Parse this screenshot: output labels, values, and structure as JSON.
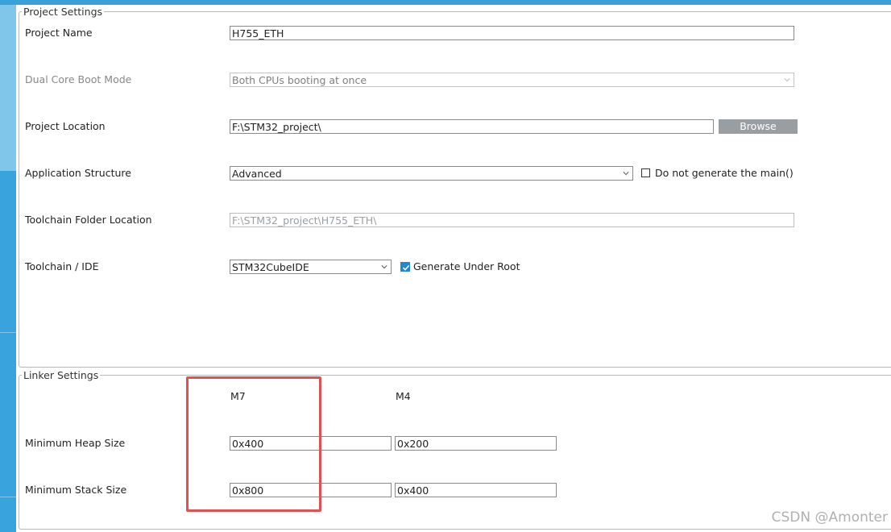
{
  "project_settings": {
    "legend": "Project Settings",
    "project_name": {
      "label": "Project Name",
      "value": "H755_ETH"
    },
    "dual_core_boot_mode": {
      "label": "Dual Core Boot Mode",
      "value": "Both CPUs booting at once"
    },
    "project_location": {
      "label": "Project Location",
      "value": "F:\\STM32_project\\",
      "browse_label": "Browse"
    },
    "application_structure": {
      "label": "Application Structure",
      "value": "Advanced",
      "checkbox_label": "Do not generate the main()",
      "checkbox_checked": false
    },
    "toolchain_folder_location": {
      "label": "Toolchain Folder Location",
      "value": "F:\\STM32_project\\H755_ETH\\"
    },
    "toolchain_ide": {
      "label": "Toolchain / IDE",
      "value": "STM32CubeIDE",
      "checkbox_label": "Generate Under Root",
      "checkbox_checked": true
    }
  },
  "linker_settings": {
    "legend": "Linker Settings",
    "col_m7": "M7",
    "col_m4": "M4",
    "min_heap": {
      "label": "Minimum Heap Size",
      "m7": "0x400",
      "m4": "0x200"
    },
    "min_stack": {
      "label": "Minimum Stack Size",
      "m7": "0x800",
      "m4": "0x400"
    }
  },
  "watermark": "CSDN @Amonter",
  "colors": {
    "accent": "#3aa0d8",
    "highlight": "#e2514f",
    "button": "#999ea3",
    "checkbox": "#1e88d6"
  }
}
